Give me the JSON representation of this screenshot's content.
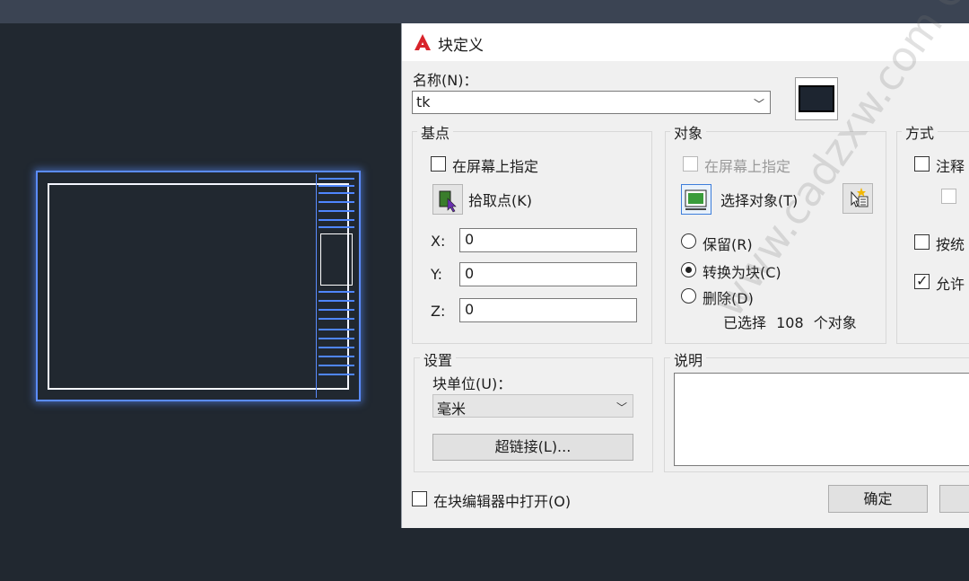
{
  "dialog": {
    "title": "块定义",
    "name_label": "名称(N)：",
    "name_value": "tk",
    "basepoint": {
      "title": "基点",
      "specify_label": "在屏幕上指定",
      "pick_label": "拾取点(K)",
      "x_label": "X:",
      "x_value": "0",
      "y_label": "Y:",
      "y_value": "0",
      "z_label": "Z:",
      "z_value": "0"
    },
    "objects": {
      "title": "对象",
      "specify_label": "在屏幕上指定",
      "select_label": "选择对象(T)",
      "retain_label": "保留(R)",
      "convert_label": "转换为块(C)",
      "delete_label": "删除(D)",
      "selected_prefix": "已选择",
      "selected_count": "108",
      "selected_suffix": "个对象"
    },
    "behavior": {
      "title": "方式",
      "annotative_label": "注释",
      "scale_uniform_label": "按统",
      "allow_explode_label": "允许"
    },
    "settings": {
      "title": "设置",
      "unit_label": "块单位(U)：",
      "unit_value": "毫米",
      "hyperlink_label": "超链接(L)..."
    },
    "description": {
      "title": "说明"
    },
    "open_editor_label": "在块编辑器中打开(O)",
    "ok_label": "确定"
  },
  "watermark": "www.cadzxw.com CAD自学网",
  "colors": {
    "canvas_bg": "#212830",
    "selection_blue": "#5b8cff",
    "dialog_bg": "#f0f0f0"
  },
  "icons": [
    "autocad-logo-icon",
    "pick-point-icon",
    "select-objects-icon",
    "quick-select-icon",
    "chevron-down-icon"
  ]
}
